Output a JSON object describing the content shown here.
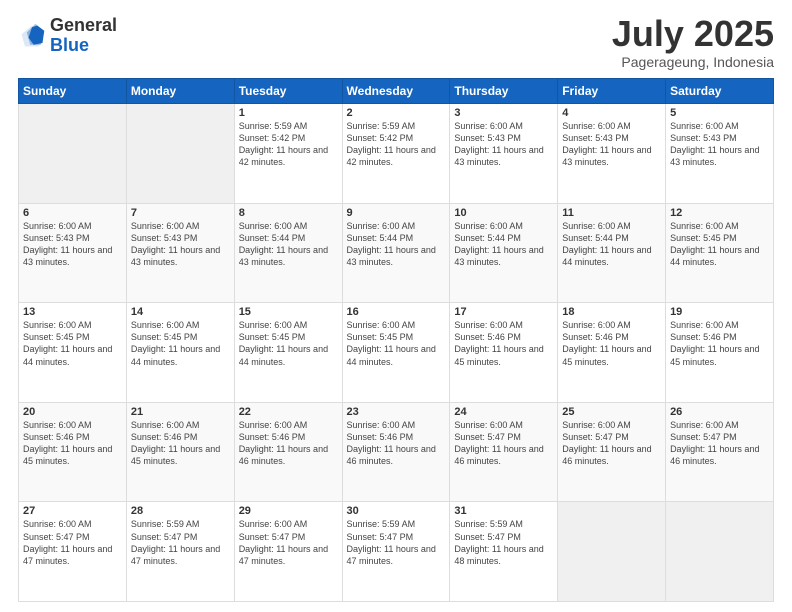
{
  "logo": {
    "general": "General",
    "blue": "Blue"
  },
  "header": {
    "month": "July 2025",
    "location": "Pagerageung, Indonesia"
  },
  "weekdays": [
    "Sunday",
    "Monday",
    "Tuesday",
    "Wednesday",
    "Thursday",
    "Friday",
    "Saturday"
  ],
  "weeks": [
    [
      {
        "day": "",
        "info": ""
      },
      {
        "day": "",
        "info": ""
      },
      {
        "day": "1",
        "info": "Sunrise: 5:59 AM\nSunset: 5:42 PM\nDaylight: 11 hours and 42 minutes."
      },
      {
        "day": "2",
        "info": "Sunrise: 5:59 AM\nSunset: 5:42 PM\nDaylight: 11 hours and 42 minutes."
      },
      {
        "day": "3",
        "info": "Sunrise: 6:00 AM\nSunset: 5:43 PM\nDaylight: 11 hours and 43 minutes."
      },
      {
        "day": "4",
        "info": "Sunrise: 6:00 AM\nSunset: 5:43 PM\nDaylight: 11 hours and 43 minutes."
      },
      {
        "day": "5",
        "info": "Sunrise: 6:00 AM\nSunset: 5:43 PM\nDaylight: 11 hours and 43 minutes."
      }
    ],
    [
      {
        "day": "6",
        "info": "Sunrise: 6:00 AM\nSunset: 5:43 PM\nDaylight: 11 hours and 43 minutes."
      },
      {
        "day": "7",
        "info": "Sunrise: 6:00 AM\nSunset: 5:43 PM\nDaylight: 11 hours and 43 minutes."
      },
      {
        "day": "8",
        "info": "Sunrise: 6:00 AM\nSunset: 5:44 PM\nDaylight: 11 hours and 43 minutes."
      },
      {
        "day": "9",
        "info": "Sunrise: 6:00 AM\nSunset: 5:44 PM\nDaylight: 11 hours and 43 minutes."
      },
      {
        "day": "10",
        "info": "Sunrise: 6:00 AM\nSunset: 5:44 PM\nDaylight: 11 hours and 43 minutes."
      },
      {
        "day": "11",
        "info": "Sunrise: 6:00 AM\nSunset: 5:44 PM\nDaylight: 11 hours and 44 minutes."
      },
      {
        "day": "12",
        "info": "Sunrise: 6:00 AM\nSunset: 5:45 PM\nDaylight: 11 hours and 44 minutes."
      }
    ],
    [
      {
        "day": "13",
        "info": "Sunrise: 6:00 AM\nSunset: 5:45 PM\nDaylight: 11 hours and 44 minutes."
      },
      {
        "day": "14",
        "info": "Sunrise: 6:00 AM\nSunset: 5:45 PM\nDaylight: 11 hours and 44 minutes."
      },
      {
        "day": "15",
        "info": "Sunrise: 6:00 AM\nSunset: 5:45 PM\nDaylight: 11 hours and 44 minutes."
      },
      {
        "day": "16",
        "info": "Sunrise: 6:00 AM\nSunset: 5:45 PM\nDaylight: 11 hours and 44 minutes."
      },
      {
        "day": "17",
        "info": "Sunrise: 6:00 AM\nSunset: 5:46 PM\nDaylight: 11 hours and 45 minutes."
      },
      {
        "day": "18",
        "info": "Sunrise: 6:00 AM\nSunset: 5:46 PM\nDaylight: 11 hours and 45 minutes."
      },
      {
        "day": "19",
        "info": "Sunrise: 6:00 AM\nSunset: 5:46 PM\nDaylight: 11 hours and 45 minutes."
      }
    ],
    [
      {
        "day": "20",
        "info": "Sunrise: 6:00 AM\nSunset: 5:46 PM\nDaylight: 11 hours and 45 minutes."
      },
      {
        "day": "21",
        "info": "Sunrise: 6:00 AM\nSunset: 5:46 PM\nDaylight: 11 hours and 45 minutes."
      },
      {
        "day": "22",
        "info": "Sunrise: 6:00 AM\nSunset: 5:46 PM\nDaylight: 11 hours and 46 minutes."
      },
      {
        "day": "23",
        "info": "Sunrise: 6:00 AM\nSunset: 5:46 PM\nDaylight: 11 hours and 46 minutes."
      },
      {
        "day": "24",
        "info": "Sunrise: 6:00 AM\nSunset: 5:47 PM\nDaylight: 11 hours and 46 minutes."
      },
      {
        "day": "25",
        "info": "Sunrise: 6:00 AM\nSunset: 5:47 PM\nDaylight: 11 hours and 46 minutes."
      },
      {
        "day": "26",
        "info": "Sunrise: 6:00 AM\nSunset: 5:47 PM\nDaylight: 11 hours and 46 minutes."
      }
    ],
    [
      {
        "day": "27",
        "info": "Sunrise: 6:00 AM\nSunset: 5:47 PM\nDaylight: 11 hours and 47 minutes."
      },
      {
        "day": "28",
        "info": "Sunrise: 5:59 AM\nSunset: 5:47 PM\nDaylight: 11 hours and 47 minutes."
      },
      {
        "day": "29",
        "info": "Sunrise: 6:00 AM\nSunset: 5:47 PM\nDaylight: 11 hours and 47 minutes."
      },
      {
        "day": "30",
        "info": "Sunrise: 5:59 AM\nSunset: 5:47 PM\nDaylight: 11 hours and 47 minutes."
      },
      {
        "day": "31",
        "info": "Sunrise: 5:59 AM\nSunset: 5:47 PM\nDaylight: 11 hours and 48 minutes."
      },
      {
        "day": "",
        "info": ""
      },
      {
        "day": "",
        "info": ""
      }
    ]
  ]
}
